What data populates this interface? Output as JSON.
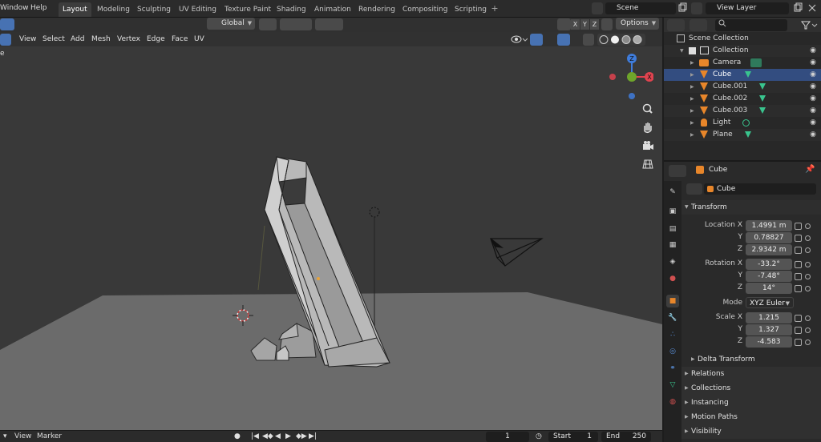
{
  "top_menu": {
    "window": "Window",
    "help": "Help"
  },
  "workspace_tabs": [
    "Layout",
    "Modeling",
    "Sculpting",
    "UV Editing",
    "Texture Paint",
    "Shading",
    "Animation",
    "Rendering",
    "Compositing",
    "Scripting"
  ],
  "workspace_add": "+",
  "scene": {
    "name": "Scene",
    "view_layer": "View Layer"
  },
  "viewport": {
    "menu": [
      "View",
      "Select",
      "Add",
      "Mesh",
      "Vertex",
      "Edge",
      "Face",
      "UV"
    ],
    "transform_orientation": "Global",
    "axis_locks": [
      "X",
      "Y",
      "Z"
    ],
    "options_label": "Options",
    "partial_label": "e",
    "gizmo_axes": {
      "x": "X",
      "y": "Y",
      "z": "Z"
    },
    "colors": {
      "x_axis": "#e0434f",
      "y_axis": "#6ea52b",
      "z_axis": "#3f7ddd",
      "selection": "#4772b3"
    },
    "nav_icons": [
      "zoom-icon",
      "pan-hand-icon",
      "camera-view-icon",
      "grid-ortho-icon"
    ]
  },
  "timeline": {
    "menu": [
      "View",
      "Marker"
    ],
    "current_frame": "1",
    "start_label": "Start",
    "start_value": "1",
    "end_label": "End",
    "end_value": "250"
  },
  "outliner": {
    "items": [
      {
        "name": "Scene Collection",
        "type": "scene-collection",
        "level": 0
      },
      {
        "name": "Collection",
        "type": "collection",
        "level": 1
      },
      {
        "name": "Camera",
        "type": "camera",
        "level": 2
      },
      {
        "name": "Cube",
        "type": "mesh",
        "level": 2,
        "selected": true
      },
      {
        "name": "Cube.001",
        "type": "mesh",
        "level": 2
      },
      {
        "name": "Cube.002",
        "type": "mesh",
        "level": 2
      },
      {
        "name": "Cube.003",
        "type": "mesh",
        "level": 2
      },
      {
        "name": "Light",
        "type": "light",
        "level": 2
      },
      {
        "name": "Plane",
        "type": "mesh",
        "level": 2
      }
    ]
  },
  "properties": {
    "object_name": "Cube",
    "data_name": "Cube",
    "transform_header": "Transform",
    "location": {
      "label": "Location X",
      "x": "1.4991 m",
      "y": "0.78827",
      "z": "2.9342 m"
    },
    "rotation": {
      "label": "Rotation X",
      "x": "-33.2°",
      "y": "-7.48°",
      "z": "14°"
    },
    "mode": {
      "label": "Mode",
      "value": "XYZ Euler"
    },
    "scale": {
      "label": "Scale X",
      "x": "1.215",
      "y": "1.327",
      "z": "-4.583"
    },
    "axis_y": "Y",
    "axis_z": "Z",
    "delta_transform": "Delta Transform",
    "panels": [
      "Relations",
      "Collections",
      "Instancing",
      "Motion Paths",
      "Visibility"
    ]
  }
}
